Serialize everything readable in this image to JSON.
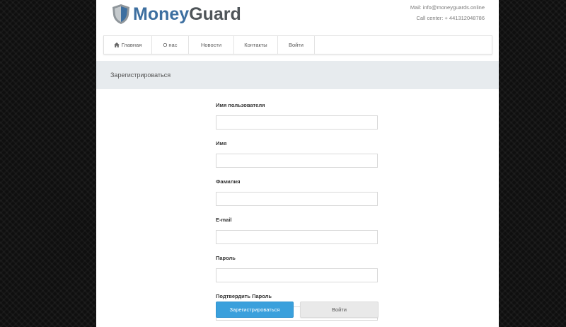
{
  "header": {
    "logo_part1": "Money",
    "logo_part2": "Guard",
    "mail": "Mail: info@moneyguards.online",
    "call": "Call center: + 441312048786"
  },
  "nav": {
    "items": [
      {
        "label": "Главная",
        "icon": "home-icon"
      },
      {
        "label": "О нас"
      },
      {
        "label": "Новости"
      },
      {
        "label": "Контакты"
      },
      {
        "label": "Войти"
      }
    ]
  },
  "page_title": "Зарегистрироваться",
  "form": {
    "fields": [
      {
        "label": "Имя пользователя",
        "value": "",
        "placeholder": ""
      },
      {
        "label": "Имя",
        "value": "",
        "placeholder": ""
      },
      {
        "label": "Фамилия",
        "value": "",
        "placeholder": ""
      },
      {
        "label": "E-mail",
        "value": "",
        "placeholder": ""
      },
      {
        "label": "Пароль",
        "value": "",
        "placeholder": ""
      },
      {
        "label": "Подтвердить Пароль",
        "value": "",
        "placeholder": "Подтвердить Пароль"
      }
    ],
    "submit_label": "Зарегистрироваться",
    "login_label": "Войти"
  },
  "colors": {
    "accent": "#3aa0dc",
    "logo_blue": "#3d6fa0",
    "logo_gray": "#4f5559",
    "title_bar": "#e7ebee"
  }
}
